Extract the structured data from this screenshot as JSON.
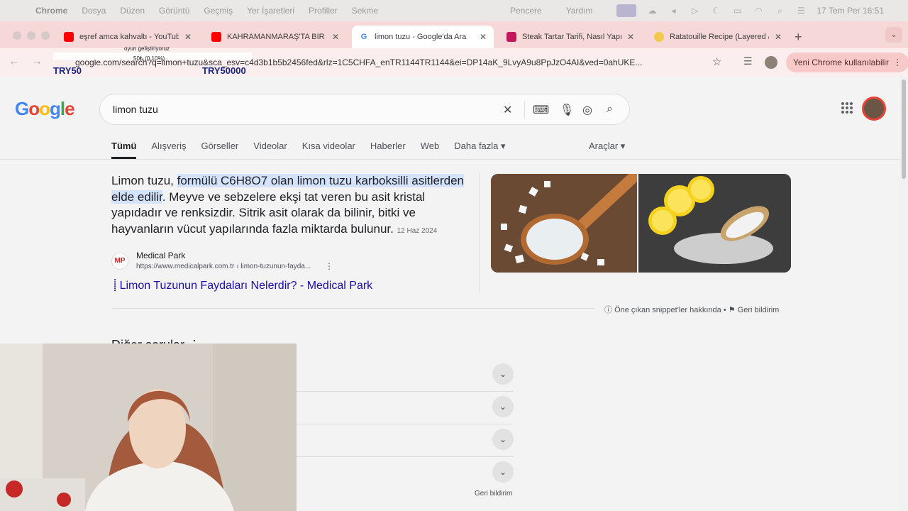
{
  "menubar": {
    "app": "Chrome",
    "items": [
      "Dosya",
      "Düzen",
      "Görüntü",
      "Geçmiş",
      "Yer İşaretleri",
      "Profiller",
      "Sekme"
    ],
    "right_items": [
      "Pencere",
      "Yardım"
    ],
    "clock": "17 Tem Per  16:51"
  },
  "tabs": [
    {
      "title": "eşref amca kahvaltı - YouTube",
      "favicon_color": "#ff0000"
    },
    {
      "title": "KAHRAMANMARAŞ'TA BİR GÜN",
      "favicon_color": "#ff0000"
    },
    {
      "title": "limon tuzu - Google'da Ara",
      "favicon_color": "#4285f4",
      "active": true
    },
    {
      "title": "Steak Tartar Tarifi, Nasıl Yapılır",
      "favicon_color": "#c2185b"
    },
    {
      "title": "Ratatouille Recipe (Layered &",
      "favicon_color": "#f2c94c"
    }
  ],
  "toolbar": {
    "url": "google.com/search?q=limon+tuzu&sca_esv=c4d3b1b5b2456fed&rlz=1C5CHFA_enTR1144TR1144&ei=DP14aK_9LvyA9u8PpJzO4AI&ved=0ahUKE...",
    "update_label": "Yeni Chrome kullanılabilir"
  },
  "ticker": {
    "line1": "oyun geliştiriyoruz",
    "line2": "50₺ (0.10%)",
    "left_amount": "TRY50",
    "right_amount": "TRY50000"
  },
  "search": {
    "query": "limon tuzu",
    "tabs": [
      "Tümü",
      "Alışveriş",
      "Görseller",
      "Videolar",
      "Kısa videolar",
      "Haberler",
      "Web",
      "Daha fazla ▾"
    ],
    "tools": "Araçlar ▾"
  },
  "snippet": {
    "prefix": "Limon tuzu, ",
    "highlight": "formülü C6H8O7 olan limon tuzu karboksilli asitlerden elde edilir",
    "rest": ". Meyve ve sebzelere ekşi tat veren bu asit kristal yapıdadır ve renksizdir. Sitrik asit olarak da bilinir, bitki ve hayvanların vücut yapılarında fazla miktarda bulunur.",
    "date": "12 Haz 2024",
    "source_logo": "MP",
    "source_name": "Medical Park",
    "source_url": "https://www.medicalpark.com.tr › limon-tuzunun-fayda...",
    "link_text": "Limon Tuzunun Faydaları Nelerdir? - Medical Park",
    "about_label": "Öne çıkan snippet'ler hakkında",
    "feedback_label": "Geri bildirim"
  },
  "paa": {
    "title": "Diğer sorular  ⋮",
    "feedback": "Geri bildirim",
    "rows": 4
  }
}
